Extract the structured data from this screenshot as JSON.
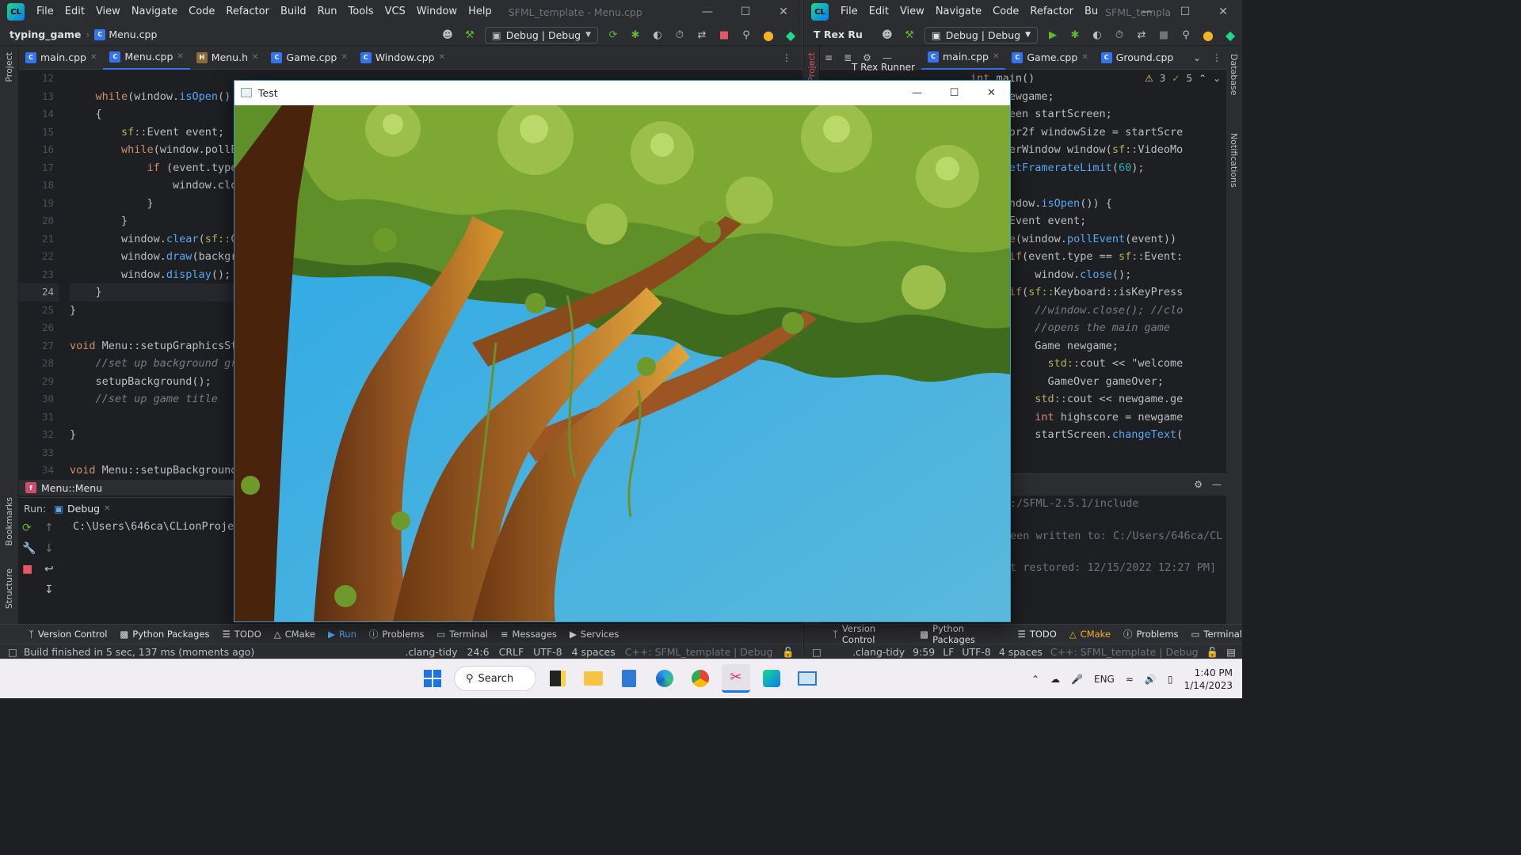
{
  "left_ide": {
    "menu": [
      "File",
      "Edit",
      "View",
      "Navigate",
      "Code",
      "Refactor",
      "Build",
      "Run",
      "Tools",
      "VCS",
      "Window",
      "Help"
    ],
    "window_title": "SFML_template - Menu.cpp",
    "breadcrumb_project": "typing_game",
    "breadcrumb_file": "Menu.cpp",
    "run_config": "Debug | Debug",
    "tabs": [
      "main.cpp",
      "Menu.cpp",
      "Menu.h",
      "Game.cpp",
      "Window.cpp"
    ],
    "active_tab": "Menu.cpp",
    "project_label": "Project",
    "line_numbers": [
      "12",
      "13",
      "14",
      "15",
      "16",
      "17",
      "18",
      "19",
      "20",
      "21",
      "22",
      "23",
      "24",
      "25",
      "26",
      "27",
      "28",
      "29",
      "30",
      "31",
      "32",
      "33",
      "34"
    ],
    "current_line": "24",
    "code_lines": [
      "",
      "    while(window.isOpen()",
      "    {",
      "        sf::Event event;",
      "        while(window.pollE",
      "            if (event.type",
      "                window.clo",
      "            }",
      "        }",
      "        window.clear(sf::C",
      "        window.draw(backgr",
      "        window.display();",
      "    }",
      "}",
      "",
      "void Menu::setupGraphicsSt",
      "    //set up background gr",
      "    setupBackground();",
      "    //set up game title",
      "",
      "}",
      "",
      "void Menu::setupBackground"
    ],
    "structure_crumb": "Menu::Menu",
    "run_label": "Run:",
    "run_tab": "Debug",
    "run_output": "C:\\Users\\646ca\\CLionProje",
    "bookmarks_label": "Bookmarks",
    "structure_label": "Structure",
    "tool_windows": [
      "Version Control",
      "Python Packages",
      "TODO",
      "CMake",
      "Run",
      "Problems",
      "Terminal",
      "Messages",
      "Services"
    ],
    "status_message": "Build finished in 5 sec, 137 ms (moments ago)",
    "status_right": [
      ".clang-tidy",
      "24:6",
      "CRLF",
      "UTF-8",
      "4 spaces",
      "C++: SFML_template | Debug"
    ]
  },
  "right_ide": {
    "menu": [
      "File",
      "Edit",
      "View",
      "Navigate",
      "Code",
      "Refactor",
      "Bu"
    ],
    "window_title": "SFML_templa",
    "project_name": "T Rex Ru",
    "run_config": "Debug | Debug",
    "tabs": [
      "main.cpp",
      "Game.cpp",
      "Ground.cpp"
    ],
    "active_tab": "main.cpp",
    "tree_item": "T Rex Runner",
    "inspections": {
      "warnings": "3",
      "ok": "5"
    },
    "code_lines": [
      "int main()",
      "Game newgame;",
      "artScreen startScreen;",
      "::Vector2f windowSize = startScre",
      "::RenderWindow window(sf::VideoMo",
      "ndow.setFramerateLimit(60);",
      "",
      "ile(window.isOpen()) {",
      "  sf::Event event;",
      "  while(window.pollEvent(event))",
      "      if(event.type == sf::Event:",
      "          window.close();",
      "      if(sf::Keyboard::isKeyPress",
      "          //window.close(); //clo",
      "          //opens the main game",
      "          Game newgame;",
      "            std::cout << \"welcome",
      "            GameOver gameOver;",
      "          std::cout << newgame.ge",
      "          int highscore = newgame",
      "          startScreen.changeText("
    ],
    "cmake_output": [
      ":/SFML-2.5.1/include",
      "een written to: C:/Users/646ca/CL",
      "t restored: 12/15/2022 12:27 PM]"
    ],
    "side_labels": [
      "Database",
      "Notifications"
    ],
    "tool_windows": [
      "Version Control",
      "Python Packages",
      "TODO",
      "CMake",
      "Problems",
      "Terminal"
    ],
    "status_right": [
      ".clang-tidy",
      "9:59",
      "LF",
      "UTF-8",
      "4 spaces",
      "C++: SFML_template | Debug"
    ]
  },
  "game_window": {
    "title": "Test",
    "sky_color": "#4bb3e0",
    "leaf_color": "#6e9a2c",
    "trunk_color": "#8a4b1c"
  },
  "taskbar": {
    "search_label": "Search",
    "language": "ENG",
    "time": "1:40 PM",
    "date": "1/14/2023",
    "apps": [
      "start-icon",
      "search",
      "sticky-notes-icon",
      "file-explorer-icon",
      "notepad-icon",
      "edge-icon",
      "chrome-icon",
      "snipping-tool-icon",
      "clion-icon",
      "remote-desktop-icon"
    ]
  }
}
